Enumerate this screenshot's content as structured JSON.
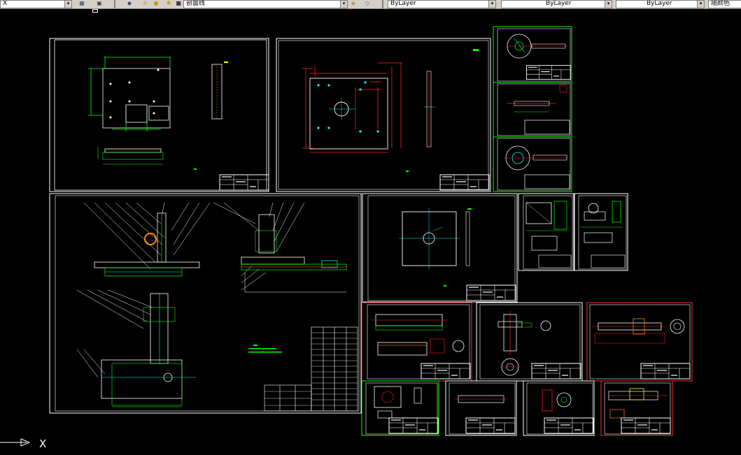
{
  "toolbar": {
    "left_combo": "X",
    "layer_combo": "剖面线",
    "color_combo": "ByLayer",
    "linetype_combo": "ByLayer",
    "lineweight_combo": "ByLayer",
    "right_combo": "随颜色"
  },
  "ucs": {
    "x_label": "X"
  },
  "colors": {
    "background": "#000000",
    "frame": "#ffffff",
    "frame_alt_green": "#00ff00",
    "frame_alt_red": "#ff3030",
    "geometry_green": "#00ff00",
    "geometry_red": "#ff2020",
    "geometry_cyan": "#00ffff",
    "geometry_white": "#ffffff",
    "geometry_yellow": "#ffff00",
    "geometry_orange": "#ff8800",
    "geometry_blue": "#4080ff"
  },
  "icons": [
    "layer-manager-icon",
    "layer-state-icon",
    "freeze-icon",
    "lock-icon",
    "color-icon",
    "print-icon",
    "match-properties-icon"
  ]
}
